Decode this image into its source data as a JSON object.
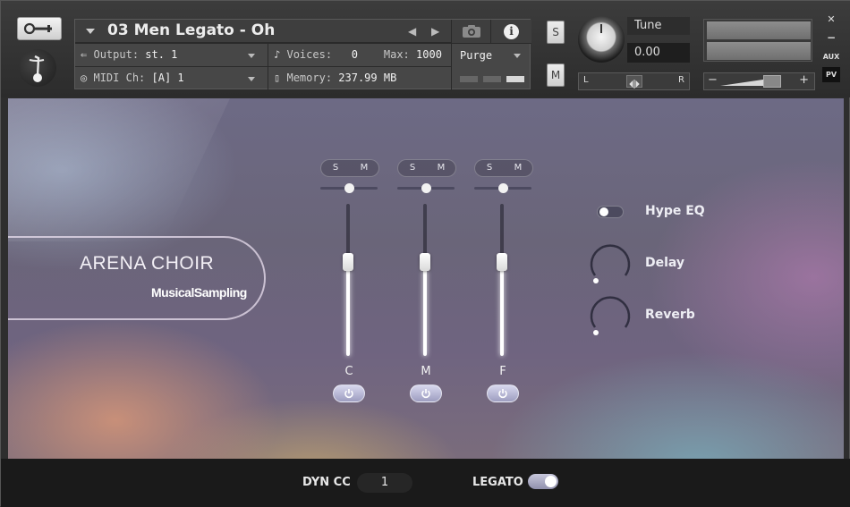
{
  "header": {
    "instrument_title": "03 Men Legato - Oh",
    "output_label": "Output:",
    "output_value": "st. 1",
    "voices_label": "Voices:",
    "voices_value": "0",
    "max_label": "Max:",
    "max_value": "1000",
    "midi_label": "MIDI Ch:",
    "midi_value": "[A]  1",
    "memory_label": "Memory:",
    "memory_value": "237.99 MB",
    "purge_label": "Purge",
    "solo_label": "S",
    "mute_label": "M",
    "tune_label": "Tune",
    "tune_value": "0.00",
    "pan_left": "L",
    "pan_right": "R",
    "vol_minus": "−",
    "vol_plus": "+",
    "aux_label": "AUX",
    "pv_label": "PV",
    "close_label": "✕",
    "minimize_label": "−"
  },
  "brand": {
    "title": "ARENA CHOIR",
    "subtitle": "MusicalSampling"
  },
  "channels": [
    {
      "label": "C",
      "solo": "S",
      "mute": "M",
      "level": 0.62
    },
    {
      "label": "M",
      "solo": "S",
      "mute": "M",
      "level": 0.62
    },
    {
      "label": "F",
      "solo": "S",
      "mute": "M",
      "level": 0.62
    }
  ],
  "effects": {
    "hype_eq_label": "Hype EQ",
    "delay_label": "Delay",
    "reverb_label": "Reverb"
  },
  "footer": {
    "dyn_cc_label": "DYN CC",
    "dyn_cc_value": "1",
    "legato_label": "LEGATO"
  },
  "colors": {
    "header_bg": "#333333",
    "footer_bg": "#1a1a1a",
    "accent_white": "#ffffff"
  }
}
